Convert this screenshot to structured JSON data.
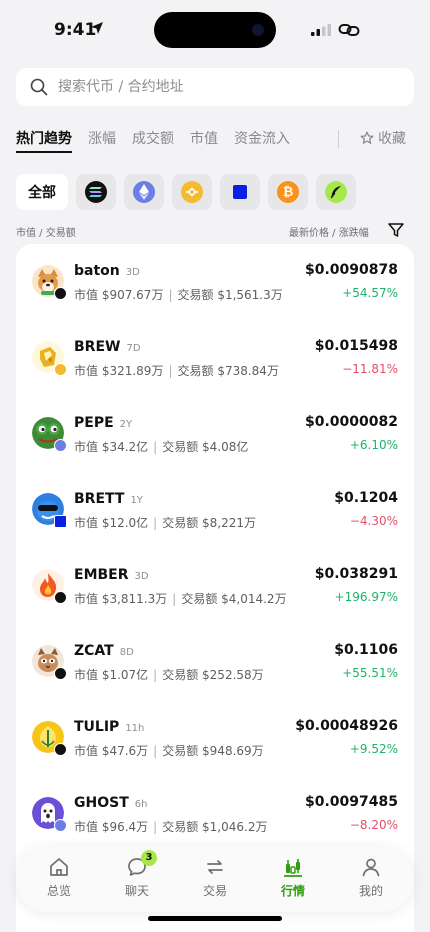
{
  "status_bar": {
    "time": "9:41"
  },
  "search": {
    "placeholder": "搜索代币 / 合约地址"
  },
  "tabs": [
    {
      "label": "热门趋势",
      "active": true
    },
    {
      "label": "涨幅"
    },
    {
      "label": "成交额"
    },
    {
      "label": "市值"
    },
    {
      "label": "资金流入"
    }
  ],
  "favorites_label": "收藏",
  "chains": {
    "all_label": "全部",
    "items": [
      "solana-icon",
      "ethereum-icon",
      "bnb-icon",
      "base-icon",
      "bitcoin-icon",
      "feather-chain-icon"
    ]
  },
  "sort": {
    "left": "市值  /  交易额",
    "right": "最新价格  /  涨跌幅"
  },
  "tokens": [
    {
      "name": "baton",
      "age": "3D",
      "mcap": "市值 $907.67万",
      "volume": "交易额 $1,561.3万",
      "price": "$0.0090878",
      "change": "+54.57%",
      "dir": "up",
      "chain": "solana",
      "avatar": "dog-avatar-icon"
    },
    {
      "name": "BREW",
      "age": "7D",
      "mcap": "市值 $321.89万",
      "volume": "交易额 $738.84万",
      "price": "$0.015498",
      "change": "−11.81%",
      "dir": "down",
      "chain": "bnb",
      "avatar": "brew-logo-icon"
    },
    {
      "name": "PEPE",
      "age": "2Y",
      "mcap": "市值 $34.2亿",
      "volume": "交易额 $4.08亿",
      "price": "$0.0000082",
      "change": "+6.10%",
      "dir": "up",
      "chain": "ethereum",
      "avatar": "pepe-frog-icon"
    },
    {
      "name": "BRETT",
      "age": "1Y",
      "mcap": "市值 $12.0亿",
      "volume": "交易额 $8,221万",
      "price": "$0.1204",
      "change": "−4.30%",
      "dir": "down",
      "chain": "base",
      "avatar": "brett-avatar-icon"
    },
    {
      "name": "EMBER",
      "age": "3D",
      "mcap": "市值 $3,811.3万",
      "volume": "交易额 $4,014.2万",
      "price": "$0.038291",
      "change": "+196.97%",
      "dir": "up",
      "chain": "solana",
      "avatar": "fire-icon"
    },
    {
      "name": "ZCAT",
      "age": "8D",
      "mcap": "市值 $1.07亿",
      "volume": "交易额 $252.58万",
      "price": "$0.1106",
      "change": "+55.51%",
      "dir": "up",
      "chain": "solana",
      "avatar": "cat-avatar-icon"
    },
    {
      "name": "TULIP",
      "age": "11h",
      "mcap": "市值 $47.6万",
      "volume": "交易额 $948.69万",
      "price": "$0.00048926",
      "change": "+9.52%",
      "dir": "up",
      "chain": "solana",
      "avatar": "tulip-icon"
    },
    {
      "name": "GHOST",
      "age": "6h",
      "mcap": "市值 $96.4万",
      "volume": "交易额 $1,046.2万",
      "price": "$0.0097485",
      "change": "−8.20%",
      "dir": "down",
      "chain": "ethereum",
      "avatar": "ghost-icon"
    }
  ],
  "nav": [
    {
      "label": "总览",
      "icon": "home-icon"
    },
    {
      "label": "聊天",
      "icon": "chat-icon",
      "badge": "3"
    },
    {
      "label": "交易",
      "icon": "swap-icon"
    },
    {
      "label": "行情",
      "icon": "market-chart-icon",
      "active": true
    },
    {
      "label": "我的",
      "icon": "profile-icon"
    }
  ],
  "colors": {
    "up": "#1fb36a",
    "down": "#e4506a",
    "accent": "#2f9d12",
    "badge": "#a6e84a"
  }
}
